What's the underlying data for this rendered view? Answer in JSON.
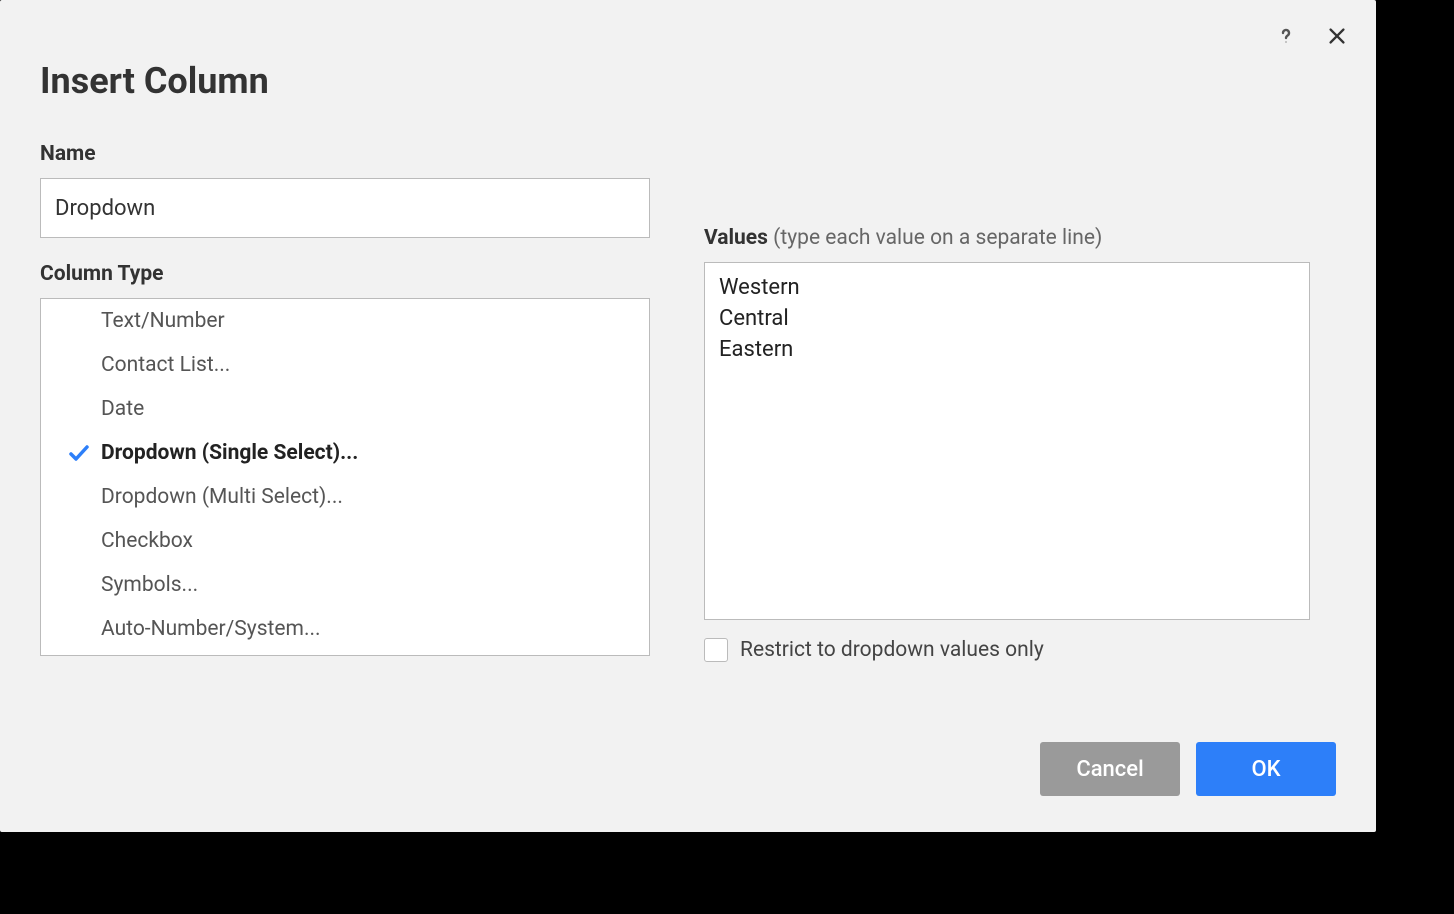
{
  "dialog": {
    "title": "Insert Column",
    "name_label": "Name",
    "name_value": "Dropdown",
    "column_type_label": "Column Type",
    "values_label": "Values ",
    "values_hint": "(type each value on a separate line)",
    "values_text": "Western\nCentral\nEastern",
    "restrict_label": "Restrict to dropdown values only",
    "restrict_checked": false,
    "cancel_label": "Cancel",
    "ok_label": "OK"
  },
  "column_types": [
    {
      "label": "Text/Number",
      "selected": false
    },
    {
      "label": "Contact List...",
      "selected": false
    },
    {
      "label": "Date",
      "selected": false
    },
    {
      "label": "Dropdown (Single Select)...",
      "selected": true
    },
    {
      "label": "Dropdown (Multi Select)...",
      "selected": false
    },
    {
      "label": "Checkbox",
      "selected": false
    },
    {
      "label": "Symbols...",
      "selected": false
    },
    {
      "label": "Auto-Number/System...",
      "selected": false
    }
  ]
}
